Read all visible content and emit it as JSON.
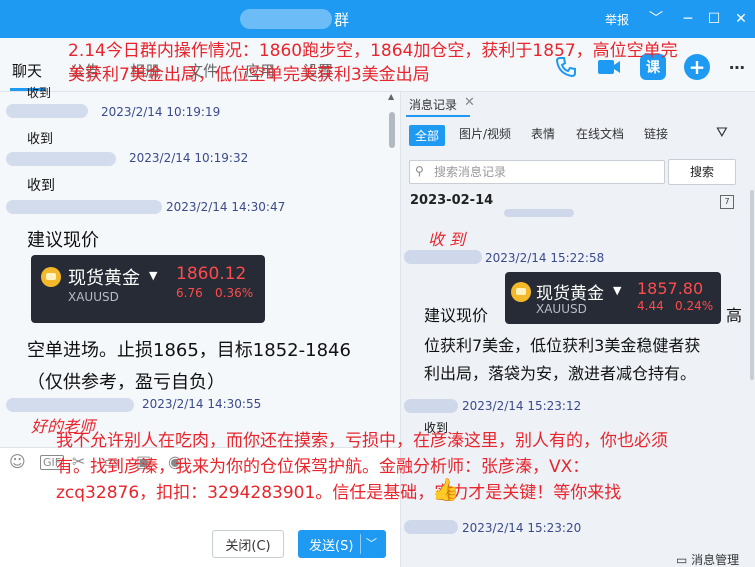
{
  "titlebar": {
    "title": "群",
    "report": "举报",
    "controls": [
      "﹀",
      "─",
      "☐",
      "✕"
    ]
  },
  "toolbar": {
    "tabs": [
      "聊天",
      "公告",
      "相册",
      "文件",
      "应用",
      "设置"
    ],
    "icons": [
      "phone-icon",
      "video-icon",
      "class-icon",
      "add-icon",
      "more-icon"
    ],
    "class_label": "课"
  },
  "ad": {
    "line1": "2.14今日群内操作情况：1860跑步空，1864加仓空，获利于1857，高位空单完",
    "line2": "美获利7美金出局，低位空单完美获利3美金出局",
    "body1": "我不允许别人在吃肉，而你还在摸索，亏损中，在彦溱这里，别人有的，你也必须",
    "body2": "有。找到彦溱，我来为你的仓位保驾护航。金融分析师：张彦溱，VX：",
    "body3": "zcq32876，扣扣：3294283901。信任是基础，实力才是关键！等你来找",
    "stamp_left": "好的老师",
    "stamp_right": "收 到"
  },
  "left_chat": {
    "messages": [
      {
        "time": "2023/2/14 10:19:19",
        "text": "收到"
      },
      {
        "time": "2023/2/14 10:19:32",
        "text": "收到"
      },
      {
        "time": "2023/2/14 14:30:47",
        "text": "建议现价"
      },
      {
        "time": "2023/2/14 14:30:55",
        "text": ""
      }
    ],
    "partial_top": "收到",
    "advice_line1": "空单进场。止损1865，目标1852-1846",
    "advice_line2": "（仅供参考，盈亏自负）"
  },
  "card_left": {
    "name": "现货黄金",
    "code": "XAUUSD",
    "price": "1860.12",
    "change": "6.76",
    "pct": "0.36%"
  },
  "card_right": {
    "name": "现货黄金",
    "code": "XAUUSD",
    "price": "1857.80",
    "change": "4.44",
    "pct": "0.24%"
  },
  "input": {
    "close_label": "关闭(C)",
    "send_label": "发送(S)",
    "gif_label": "GIF"
  },
  "right_panel": {
    "title": "消息记录",
    "filters": [
      "全部",
      "图片/视频",
      "表情",
      "在线文档",
      "链接"
    ],
    "search_placeholder": "搜索消息记录",
    "search_button": "搜索",
    "date": "2023-02-14",
    "cal_label": "7",
    "times": [
      "2023/2/14 15:22:58",
      "2023/2/14 15:23:12",
      "2023/2/14 15:23:20"
    ],
    "msg_prefix": "建议现价",
    "msg_suffix": "高",
    "msg_line2": "位获利7美金，低位获利3美金稳健者获",
    "msg_line3": "利出局，落袋为安，激进者减仓持有。",
    "msg_short": "收到",
    "footer": "消息管理"
  },
  "colors": {
    "brand": "#1e9af3",
    "ad_red": "#e8252c",
    "card_bg": "#262b36",
    "price_red": "#ff4b4b"
  }
}
